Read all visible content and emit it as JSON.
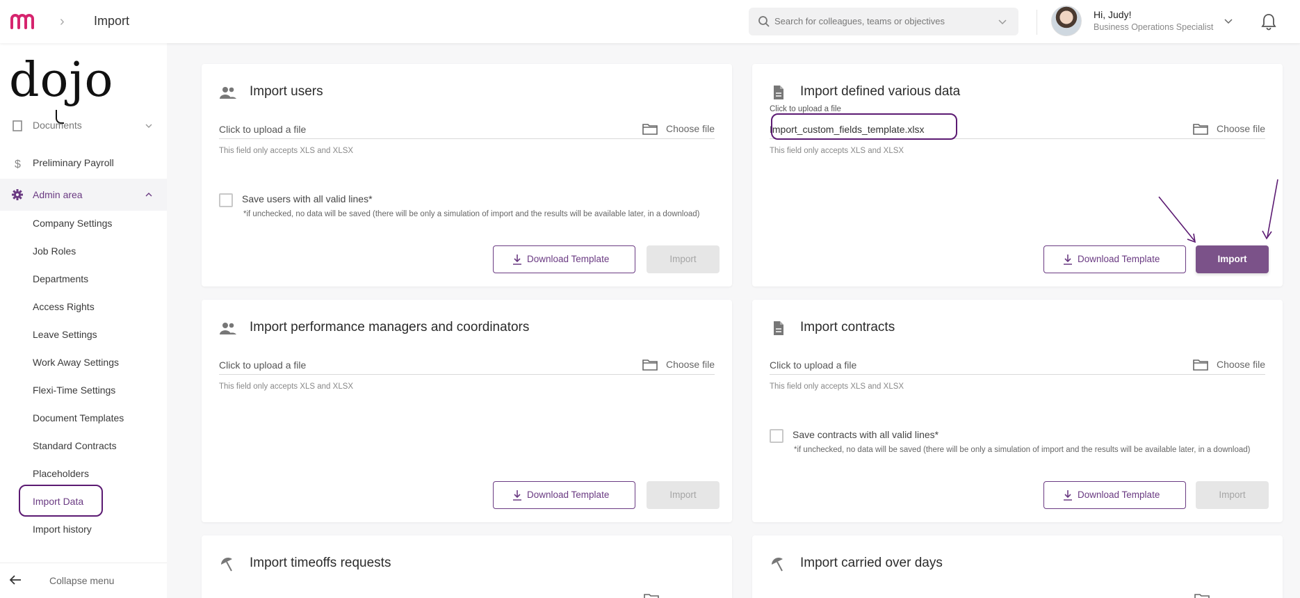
{
  "header": {
    "breadcrumb_sep": "›",
    "page": "Import",
    "search_placeholder": "Search for colleagues, teams or objectives",
    "greeting": "Hi, Judy!",
    "role": "Business Operations Specialist"
  },
  "sidebar": {
    "brand": "dojo",
    "documents": "Documents",
    "payroll": "Preliminary Payroll",
    "admin": "Admin area",
    "sub_items": [
      "Company Settings",
      "Job Roles",
      "Departments",
      "Access Rights",
      "Leave Settings",
      "Work Away Settings",
      "Flexi-Time Settings",
      "Document Templates",
      "Standard Contracts",
      "Placeholders",
      "Import Data",
      "Import history"
    ],
    "collapse": "Collapse menu"
  },
  "common": {
    "upload_placeholder": "Click to upload a file",
    "choose_file": "Choose file",
    "hint": "This field only accepts XLS and XLSX",
    "download_template": "Download Template",
    "import": "Import",
    "simulation_note": "*if unchecked, no data will be saved (there will be only a simulation of import and the results will be available later, in a download)"
  },
  "cards": {
    "users": {
      "title": "Import users",
      "checkbox": "Save users with all valid lines*"
    },
    "defined": {
      "title": "Import defined various data",
      "upload_label": "Click to upload a file",
      "file_value": "Import_custom_fields_template.xlsx"
    },
    "managers": {
      "title": "Import performance managers and coordinators"
    },
    "contracts": {
      "title": "Import contracts",
      "checkbox": "Save contracts with all valid lines*"
    },
    "timeoffs": {
      "title": "Import timeoffs requests"
    },
    "carried": {
      "title": "Import carried over days"
    }
  },
  "colors": {
    "brand": "#d6246e",
    "accent": "#6a3a82",
    "import_enabled": "#7b5289",
    "annotation": "#5b1a72"
  }
}
